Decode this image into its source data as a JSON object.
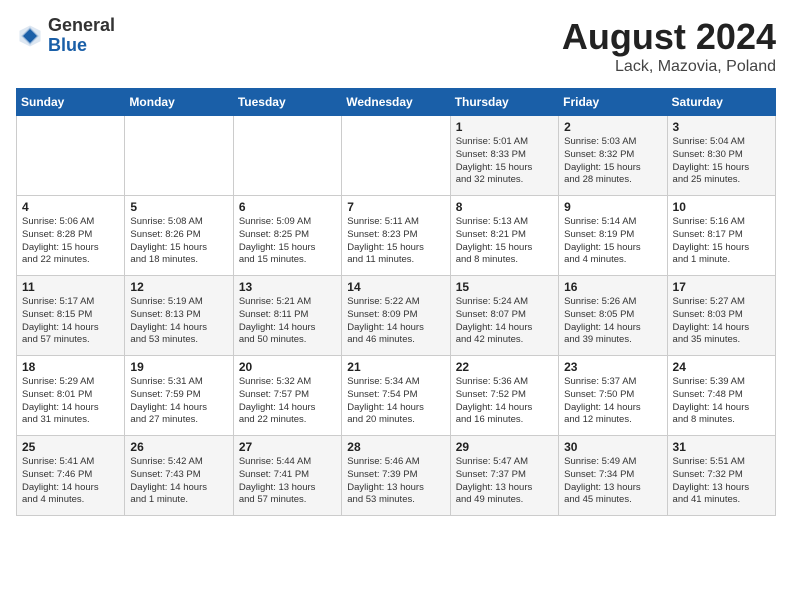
{
  "logo": {
    "general": "General",
    "blue": "Blue"
  },
  "title": {
    "month_year": "August 2024",
    "location": "Lack, Mazovia, Poland"
  },
  "weekdays": [
    "Sunday",
    "Monday",
    "Tuesday",
    "Wednesday",
    "Thursday",
    "Friday",
    "Saturday"
  ],
  "weeks": [
    [
      {
        "day": "",
        "content": ""
      },
      {
        "day": "",
        "content": ""
      },
      {
        "day": "",
        "content": ""
      },
      {
        "day": "",
        "content": ""
      },
      {
        "day": "1",
        "content": "Sunrise: 5:01 AM\nSunset: 8:33 PM\nDaylight: 15 hours\nand 32 minutes."
      },
      {
        "day": "2",
        "content": "Sunrise: 5:03 AM\nSunset: 8:32 PM\nDaylight: 15 hours\nand 28 minutes."
      },
      {
        "day": "3",
        "content": "Sunrise: 5:04 AM\nSunset: 8:30 PM\nDaylight: 15 hours\nand 25 minutes."
      }
    ],
    [
      {
        "day": "4",
        "content": "Sunrise: 5:06 AM\nSunset: 8:28 PM\nDaylight: 15 hours\nand 22 minutes."
      },
      {
        "day": "5",
        "content": "Sunrise: 5:08 AM\nSunset: 8:26 PM\nDaylight: 15 hours\nand 18 minutes."
      },
      {
        "day": "6",
        "content": "Sunrise: 5:09 AM\nSunset: 8:25 PM\nDaylight: 15 hours\nand 15 minutes."
      },
      {
        "day": "7",
        "content": "Sunrise: 5:11 AM\nSunset: 8:23 PM\nDaylight: 15 hours\nand 11 minutes."
      },
      {
        "day": "8",
        "content": "Sunrise: 5:13 AM\nSunset: 8:21 PM\nDaylight: 15 hours\nand 8 minutes."
      },
      {
        "day": "9",
        "content": "Sunrise: 5:14 AM\nSunset: 8:19 PM\nDaylight: 15 hours\nand 4 minutes."
      },
      {
        "day": "10",
        "content": "Sunrise: 5:16 AM\nSunset: 8:17 PM\nDaylight: 15 hours\nand 1 minute."
      }
    ],
    [
      {
        "day": "11",
        "content": "Sunrise: 5:17 AM\nSunset: 8:15 PM\nDaylight: 14 hours\nand 57 minutes."
      },
      {
        "day": "12",
        "content": "Sunrise: 5:19 AM\nSunset: 8:13 PM\nDaylight: 14 hours\nand 53 minutes."
      },
      {
        "day": "13",
        "content": "Sunrise: 5:21 AM\nSunset: 8:11 PM\nDaylight: 14 hours\nand 50 minutes."
      },
      {
        "day": "14",
        "content": "Sunrise: 5:22 AM\nSunset: 8:09 PM\nDaylight: 14 hours\nand 46 minutes."
      },
      {
        "day": "15",
        "content": "Sunrise: 5:24 AM\nSunset: 8:07 PM\nDaylight: 14 hours\nand 42 minutes."
      },
      {
        "day": "16",
        "content": "Sunrise: 5:26 AM\nSunset: 8:05 PM\nDaylight: 14 hours\nand 39 minutes."
      },
      {
        "day": "17",
        "content": "Sunrise: 5:27 AM\nSunset: 8:03 PM\nDaylight: 14 hours\nand 35 minutes."
      }
    ],
    [
      {
        "day": "18",
        "content": "Sunrise: 5:29 AM\nSunset: 8:01 PM\nDaylight: 14 hours\nand 31 minutes."
      },
      {
        "day": "19",
        "content": "Sunrise: 5:31 AM\nSunset: 7:59 PM\nDaylight: 14 hours\nand 27 minutes."
      },
      {
        "day": "20",
        "content": "Sunrise: 5:32 AM\nSunset: 7:57 PM\nDaylight: 14 hours\nand 22 minutes."
      },
      {
        "day": "21",
        "content": "Sunrise: 5:34 AM\nSunset: 7:54 PM\nDaylight: 14 hours\nand 20 minutes."
      },
      {
        "day": "22",
        "content": "Sunrise: 5:36 AM\nSunset: 7:52 PM\nDaylight: 14 hours\nand 16 minutes."
      },
      {
        "day": "23",
        "content": "Sunrise: 5:37 AM\nSunset: 7:50 PM\nDaylight: 14 hours\nand 12 minutes."
      },
      {
        "day": "24",
        "content": "Sunrise: 5:39 AM\nSunset: 7:48 PM\nDaylight: 14 hours\nand 8 minutes."
      }
    ],
    [
      {
        "day": "25",
        "content": "Sunrise: 5:41 AM\nSunset: 7:46 PM\nDaylight: 14 hours\nand 4 minutes."
      },
      {
        "day": "26",
        "content": "Sunrise: 5:42 AM\nSunset: 7:43 PM\nDaylight: 14 hours\nand 1 minute."
      },
      {
        "day": "27",
        "content": "Sunrise: 5:44 AM\nSunset: 7:41 PM\nDaylight: 13 hours\nand 57 minutes."
      },
      {
        "day": "28",
        "content": "Sunrise: 5:46 AM\nSunset: 7:39 PM\nDaylight: 13 hours\nand 53 minutes."
      },
      {
        "day": "29",
        "content": "Sunrise: 5:47 AM\nSunset: 7:37 PM\nDaylight: 13 hours\nand 49 minutes."
      },
      {
        "day": "30",
        "content": "Sunrise: 5:49 AM\nSunset: 7:34 PM\nDaylight: 13 hours\nand 45 minutes."
      },
      {
        "day": "31",
        "content": "Sunrise: 5:51 AM\nSunset: 7:32 PM\nDaylight: 13 hours\nand 41 minutes."
      }
    ]
  ]
}
